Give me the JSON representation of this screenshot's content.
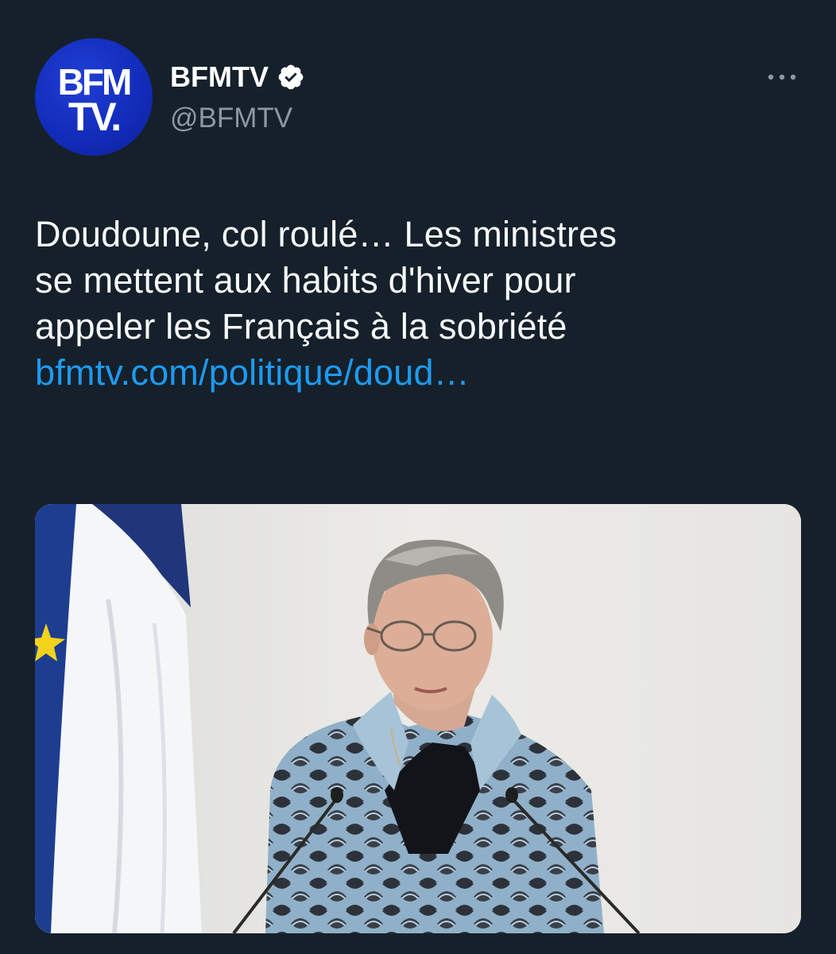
{
  "account": {
    "avatar_line1": "BFM",
    "avatar_line2": "TV.",
    "display_name": "BFMTV",
    "handle": "@BFMTV",
    "verified": true
  },
  "icons": {
    "verified": "verified-badge-icon",
    "more": "more-options-icon"
  },
  "tweet": {
    "text_lines": [
      "Doudoune, col roulé… Les ministres",
      "se mettent aux habits d'hiver pour",
      "appeler les Français à la sobriété"
    ],
    "link": "bfmtv.com/politique/doud…"
  },
  "colors": {
    "background": "#15202b",
    "link": "#1d9bf0",
    "secondary_text": "#8b98a5",
    "avatar_blue": "#1533c4"
  }
}
